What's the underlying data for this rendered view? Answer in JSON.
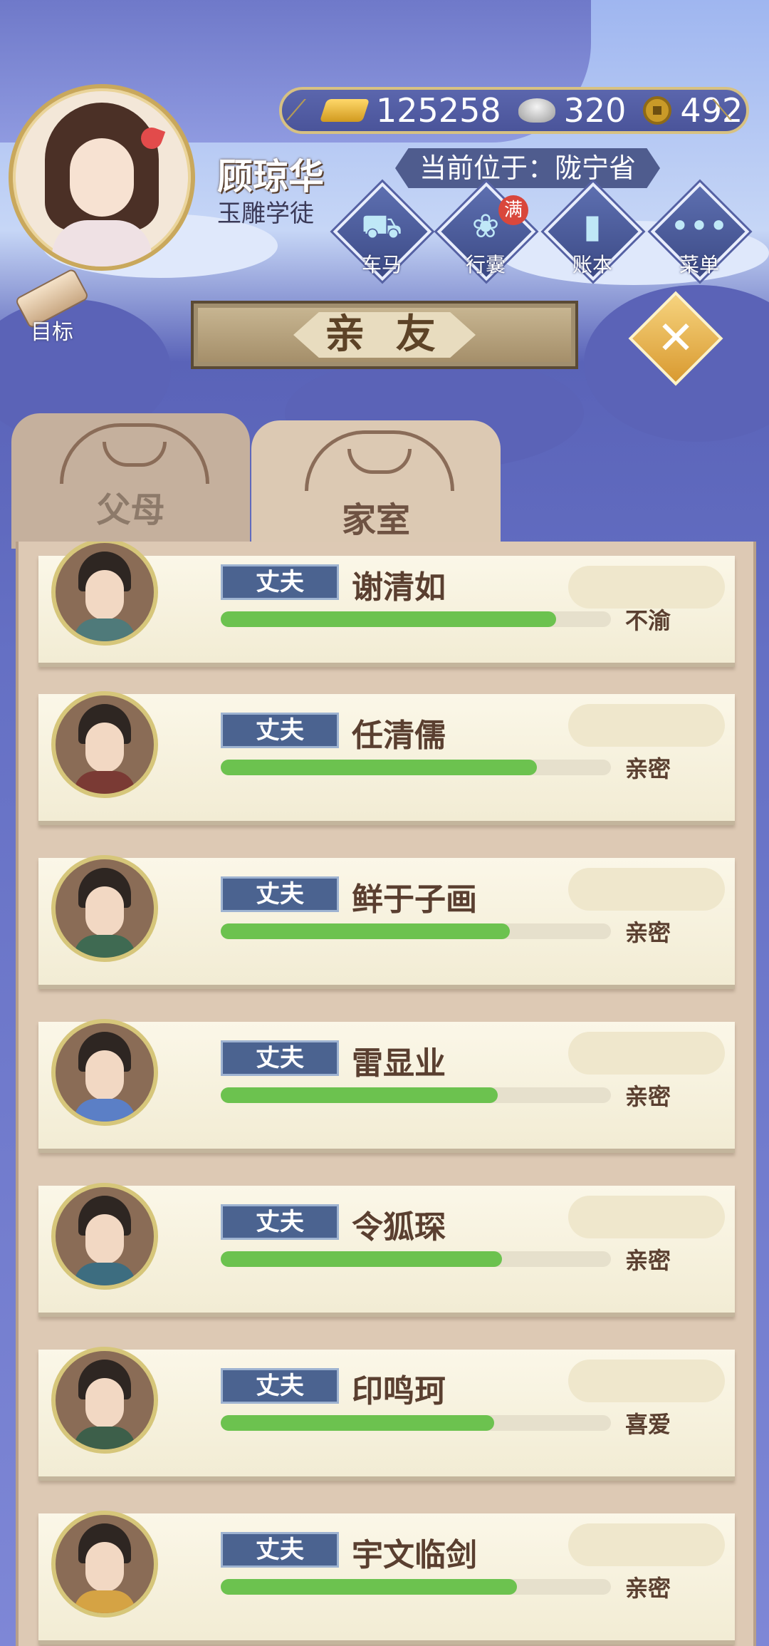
{
  "player": {
    "name": "顾琼华",
    "title": "玉雕学徒"
  },
  "currency": {
    "gold": "125258",
    "silver": "320",
    "coins": "492"
  },
  "location": "当前位于：陇宁省",
  "menu": [
    {
      "label": "车马",
      "icon": "carriage-icon"
    },
    {
      "label": "行囊",
      "icon": "bag-icon",
      "badge": "满"
    },
    {
      "label": "账本",
      "icon": "ledger-icon"
    },
    {
      "label": "菜单",
      "icon": "more-icon"
    }
  ],
  "goal_label": "目标",
  "window_title": "亲 友",
  "tabs": {
    "parents": "父母",
    "spouse": "家室",
    "active": "spouse"
  },
  "relatives": [
    {
      "role": "丈夫",
      "name": "谢清如",
      "affinity": 0.86,
      "status": "不渝",
      "robe": "#4f7a7a"
    },
    {
      "role": "丈夫",
      "name": "任清儒",
      "affinity": 0.81,
      "status": "亲密",
      "robe": "#7a3a34"
    },
    {
      "role": "丈夫",
      "name": "鲜于子画",
      "affinity": 0.74,
      "status": "亲密",
      "robe": "#3f6a52"
    },
    {
      "role": "丈夫",
      "name": "雷显业",
      "affinity": 0.71,
      "status": "亲密",
      "robe": "#5b7fc6"
    },
    {
      "role": "丈夫",
      "name": "令狐琛",
      "affinity": 0.72,
      "status": "亲密",
      "robe": "#3d6d80"
    },
    {
      "role": "丈夫",
      "name": "印鸣珂",
      "affinity": 0.7,
      "status": "喜爱",
      "robe": "#3d5f4a"
    },
    {
      "role": "丈夫",
      "name": "宇文临剑",
      "affinity": 0.76,
      "status": "亲密",
      "robe": "#d5a344"
    }
  ]
}
